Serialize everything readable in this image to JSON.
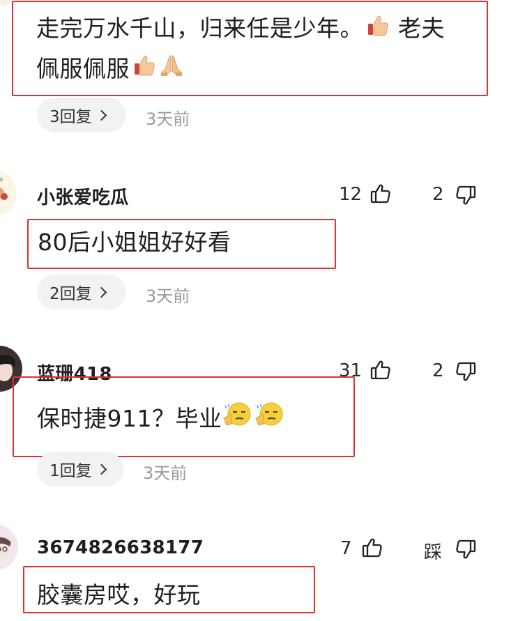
{
  "comments": [
    {
      "text_line1": "走完万水千山，归来任是少年。",
      "text_line1_tail": "老夫",
      "text_line2": "佩服佩服",
      "replies": "3回复",
      "time": "3天前"
    },
    {
      "username": "小张爱吃瓜",
      "likes": "12",
      "dislikes": "2",
      "text": "80后小姐姐好好看",
      "replies": "2回复",
      "time": "3天前"
    },
    {
      "username": "蓝珊418",
      "likes": "31",
      "dislikes": "2",
      "text": "保时捷911？毕业",
      "replies": "1回复",
      "time": "3天前"
    },
    {
      "username": "3674826638177",
      "likes": "7",
      "dislikes": "踩",
      "text": "胶囊房哎，好玩"
    }
  ],
  "colors": {
    "highlight_border": "#e03030",
    "pill_bg": "#f2f2f2",
    "time_text": "#9a9a9a"
  },
  "icons": [
    "thumbs-up-icon",
    "thumbs-down-icon",
    "chevron-right-icon",
    "thumbs-up-emoji",
    "praying-hands-emoji",
    "thinking-face-emoji"
  ]
}
